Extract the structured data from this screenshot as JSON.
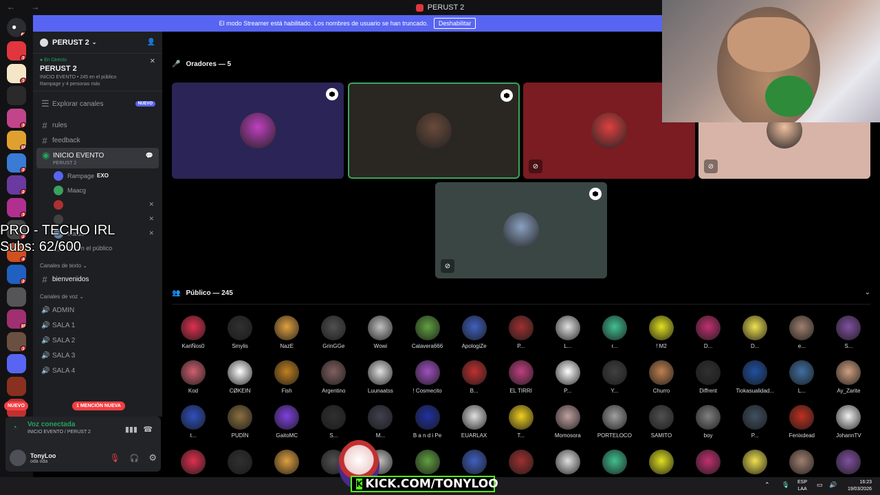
{
  "titlebar": {
    "title": "PERUST 2"
  },
  "banner": {
    "text": "El modo Streamer está habilitado. Los nombres de usuario se han truncado.",
    "button": "Deshabilitar"
  },
  "rail": {
    "home_badge": "66",
    "servers": [
      {
        "color": "#e0363d",
        "badge": "1"
      },
      {
        "color": "#f5e6c8",
        "badge": "1"
      },
      {
        "color": "#2a2a2a",
        "badge": ""
      },
      {
        "color": "#c2448a",
        "badge": "3"
      },
      {
        "color": "#e0a030",
        "badge": "18"
      },
      {
        "color": "#3a7bd5",
        "badge": "2"
      },
      {
        "color": "#6a3aa0",
        "badge": "2"
      },
      {
        "color": "#b03090",
        "badge": "3"
      },
      {
        "color": "#444",
        "badge": "2"
      },
      {
        "color": "#d05020",
        "badge": "4"
      },
      {
        "color": "#2060c0",
        "badge": "2"
      },
      {
        "color": "#555",
        "badge": ""
      },
      {
        "color": "#a03070",
        "badge": "10"
      },
      {
        "color": "#6a5040",
        "badge": "1"
      },
      {
        "color": "#5865f2",
        "badge": ""
      },
      {
        "color": "#8a3020",
        "badge": ""
      },
      {
        "color": "#c03030",
        "badge": ""
      }
    ]
  },
  "sidebar": {
    "server_name": "PERUST 2",
    "event_live": "En Directo",
    "event_title": "PERUST 2",
    "event_meta": "INICIO EVENTO • 245 en el público",
    "event_people": "Rampage y 4 personas más",
    "explore": "Explorar canales",
    "explore_badge": "NUEVO",
    "ch_rules": "rules",
    "ch_feedback": "feedback",
    "stage_name": "INICIO EVENTO",
    "stage_sub": "PERUST 2",
    "users": [
      {
        "name": "Rampage",
        "tag": "EXO",
        "color": "#5865f2"
      },
      {
        "name": "Maacg",
        "tag": "",
        "color": "#3aa060"
      },
      {
        "name": "",
        "tag": "",
        "color": "#b03030"
      },
      {
        "name": "",
        "tag": "",
        "color": "#404040"
      },
      {
        "name": "Maido",
        "tag": "",
        "color": "#6080a0"
      }
    ],
    "audience_count": "245 en el público",
    "cat_text": "Canales de texto",
    "ch_bienvenidos": "bienvenidos",
    "cat_voice": "Canales de voz",
    "voice_channels": [
      "ADMIN",
      "SALA 1",
      "SALA 2",
      "SALA 3",
      "SALA 4"
    ],
    "mention": "1 MENCIÓN NUEVA",
    "nuevo": "NUEVO"
  },
  "overlay": {
    "line1": "PRO - TECHO IRL",
    "line2": "Subs: 62/600"
  },
  "voice": {
    "status": "Voz conectada",
    "channel": "INICIO EVENTO / PERUST 2"
  },
  "user": {
    "name": "TonyLoo",
    "status": "oda oda"
  },
  "stage": {
    "speakers_label": "Oradores — 5",
    "audience_label": "Público — 245",
    "speakers": [
      {
        "bg": "#2b2456",
        "avatar": "#c040c0"
      },
      {
        "bg": "#2a2622",
        "avatar": "#6a4a3a"
      },
      {
        "bg": "#7a1c22",
        "avatar": "#e04040"
      },
      {
        "bg": "#d8b4a8",
        "avatar": "#f0c0a0"
      },
      {
        "bg": "#3a4644",
        "avatar": "#8aa0c0"
      }
    ],
    "audience": [
      [
        "KariÑos0",
        "Smylis",
        "NazE",
        "GrinGGe",
        "Wowi",
        "Calavera666",
        "ApologiZe",
        "P...",
        "L...",
        "r...",
        "! M2",
        "D...",
        "D...",
        "e...",
        "S..."
      ],
      [
        "Kod",
        "CØKEIN",
        "Fish",
        "Argentino",
        "Luunaatss",
        "! Cosmecito",
        "B...",
        "EL TIRRI",
        "P...",
        "Y...",
        "Churro",
        "Diffrent",
        "Tiokasualidad...",
        "L...",
        "Ay_Zarite"
      ],
      [
        "t...",
        "PUDÍN",
        "GaitoMC",
        "S...",
        "M...",
        "B a n d i Pe",
        "EUARLAX",
        "T...",
        "Momosora",
        "PORTELOCO",
        "SAMITO",
        "boy",
        "P...",
        "Fenixdead",
        "JohannTV"
      ],
      [
        "",
        "",
        "",
        "",
        "",
        "",
        "",
        "",
        "",
        "",
        "",
        "",
        "",
        "",
        ""
      ]
    ],
    "audience_colors": [
      "#e03050",
      "#303030",
      "#e0a040",
      "#505050",
      "#c0c0c0",
      "#60a040",
      "#4060c0",
      "#a03030",
      "#e0e0e0",
      "#40c090",
      "#e0e020",
      "#c03070",
      "#f0e050",
      "#a08070",
      "#8050a0",
      "#d06070",
      "#fff",
      "#c08020",
      "#806060",
      "#e0e0e0",
      "#a050c0",
      "#c03030",
      "#c04080",
      "#ffffff",
      "#404040",
      "#c08050",
      "#303030",
      "#2050a0",
      "#4070a0",
      "#d0a080",
      "#3050c0",
      "#8a7040",
      "#8040e0",
      "#303030",
      "#404050",
      "#2030a0",
      "#e0e0e0",
      "#f0d020",
      "#c0a0a0",
      "#a0a0a0",
      "#505050",
      "#808080",
      "#405060",
      "#c03020",
      "#f0f0f0"
    ]
  },
  "kick": {
    "text": "KICK.COM/TONYLOO"
  },
  "tray": {
    "lang1": "ESP",
    "lang2": "LAA",
    "time": "16:23",
    "date": "19/03/2026"
  }
}
